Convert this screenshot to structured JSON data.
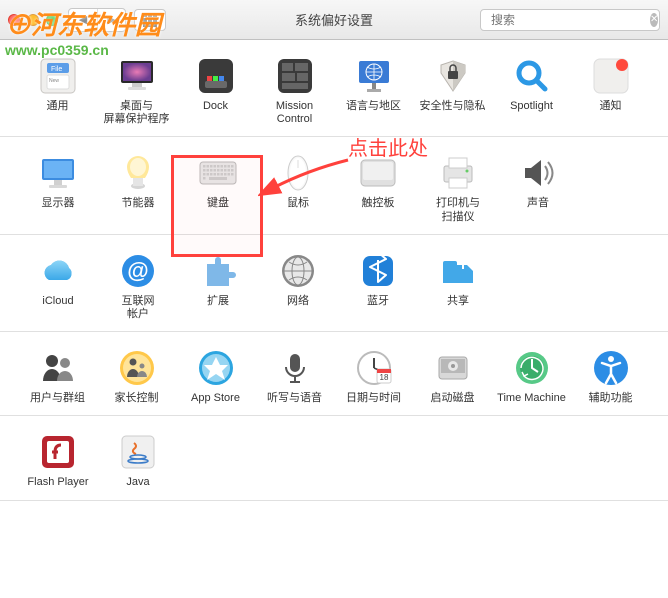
{
  "window": {
    "title": "系统偏好设置"
  },
  "search": {
    "placeholder": "搜索"
  },
  "annotation": {
    "text": "点击此处"
  },
  "watermark": {
    "name": "河东软件园",
    "url": "www.pc0359.cn"
  },
  "sections": [
    {
      "items": [
        {
          "key": "general",
          "label": "通用"
        },
        {
          "key": "desktop",
          "label": "桌面与\n屏幕保护程序"
        },
        {
          "key": "dock",
          "label": "Dock"
        },
        {
          "key": "mission",
          "label": "Mission\nControl"
        },
        {
          "key": "language",
          "label": "语言与地区"
        },
        {
          "key": "security",
          "label": "安全性与隐私"
        },
        {
          "key": "spotlight",
          "label": "Spotlight"
        },
        {
          "key": "notifications",
          "label": "通知"
        }
      ]
    },
    {
      "items": [
        {
          "key": "displays",
          "label": "显示器"
        },
        {
          "key": "energy",
          "label": "节能器"
        },
        {
          "key": "keyboard",
          "label": "键盘"
        },
        {
          "key": "mouse",
          "label": "鼠标"
        },
        {
          "key": "trackpad",
          "label": "触控板"
        },
        {
          "key": "printers",
          "label": "打印机与\n扫描仪"
        },
        {
          "key": "sound",
          "label": "声音"
        }
      ]
    },
    {
      "items": [
        {
          "key": "icloud",
          "label": "iCloud"
        },
        {
          "key": "internet",
          "label": "互联网\n帐户"
        },
        {
          "key": "extensions",
          "label": "扩展"
        },
        {
          "key": "network",
          "label": "网络"
        },
        {
          "key": "bluetooth",
          "label": "蓝牙"
        },
        {
          "key": "sharing",
          "label": "共享"
        }
      ]
    },
    {
      "items": [
        {
          "key": "users",
          "label": "用户与群组"
        },
        {
          "key": "parental",
          "label": "家长控制"
        },
        {
          "key": "appstore",
          "label": "App Store"
        },
        {
          "key": "dictation",
          "label": "听写与语音"
        },
        {
          "key": "datetime",
          "label": "日期与时间"
        },
        {
          "key": "startup",
          "label": "启动磁盘"
        },
        {
          "key": "timemachine",
          "label": "Time Machine"
        },
        {
          "key": "accessibility",
          "label": "辅助功能"
        }
      ]
    },
    {
      "items": [
        {
          "key": "flash",
          "label": "Flash Player"
        },
        {
          "key": "java",
          "label": "Java"
        }
      ]
    }
  ]
}
